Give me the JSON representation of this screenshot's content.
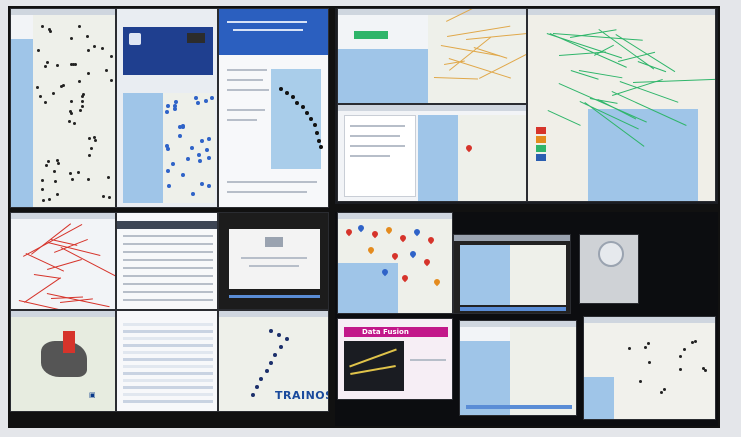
{
  "scene": {
    "description_free": true,
    "walls": [
      {
        "id": "top-left-quadrant"
      },
      {
        "id": "top-right-quadrant"
      },
      {
        "id": "bottom-left-quadrant"
      },
      {
        "id": "bottom-right-quadrant"
      }
    ]
  },
  "texts": {
    "data_fusion_title": "Data Fusion",
    "trainos_logo": "TRAINOS"
  },
  "colors": {
    "bezel": "#111111",
    "sea": "#9fc5e8",
    "road": "#e0a84a",
    "accent_magenta": "#c2188a",
    "marker_red": "#d6342b",
    "marker_blue": "#2f63c8",
    "route_green": "#2fb56a"
  }
}
